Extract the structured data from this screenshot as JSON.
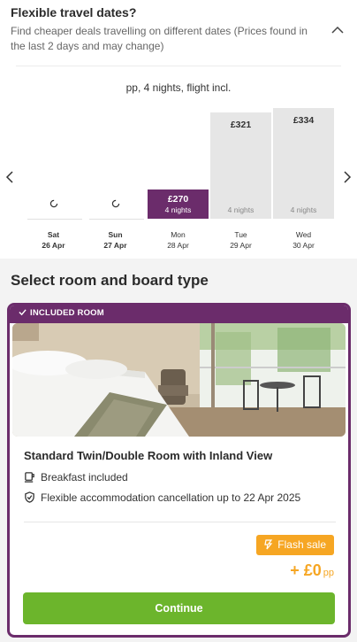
{
  "flex": {
    "title": "Flexible travel dates?",
    "subtitle": "Find cheaper deals travelling on different dates (Prices found in the last 2 days and may change)",
    "summary": "pp, 4 nights, flight incl."
  },
  "days": [
    {
      "dow": "Sat",
      "date": "26 Apr",
      "price": "",
      "nights": "",
      "state": "loading",
      "bold": true
    },
    {
      "dow": "Sun",
      "date": "27 Apr",
      "price": "",
      "nights": "",
      "state": "loading",
      "bold": true
    },
    {
      "dow": "Mon",
      "date": "28 Apr",
      "price": "£270",
      "nights": "4 nights",
      "state": "selected",
      "bold": false
    },
    {
      "dow": "Tue",
      "date": "29 Apr",
      "price": "£321",
      "nights": "4 nights",
      "state": "normal",
      "bold": false
    },
    {
      "dow": "Wed",
      "date": "30 Apr",
      "price": "£334",
      "nights": "4 nights",
      "state": "normal",
      "bold": false
    }
  ],
  "chart_data": {
    "type": "bar",
    "categories": [
      "Sat 26 Apr",
      "Sun 27 Apr",
      "Mon 28 Apr",
      "Tue 29 Apr",
      "Wed 30 Apr"
    ],
    "values": [
      null,
      null,
      270,
      321,
      334
    ],
    "unit": "£"
  },
  "section": {
    "title": "Select room and board type"
  },
  "card": {
    "badge": "INCLUDED ROOM",
    "room_name": "Standard Twin/Double Room with Inland View",
    "features": [
      {
        "icon": "cup-icon",
        "label": "Breakfast included"
      },
      {
        "icon": "shield-check-icon",
        "label": "Flexible accommodation cancellation up to 22 Apr 2025"
      }
    ],
    "flash_label": "Flash sale",
    "price": "+ £0",
    "price_unit": "pp",
    "continue_label": "Continue"
  },
  "colors": {
    "brand_purple": "#6b2c6b",
    "flash_orange": "#f6a623",
    "continue_green": "#6cb52c"
  }
}
